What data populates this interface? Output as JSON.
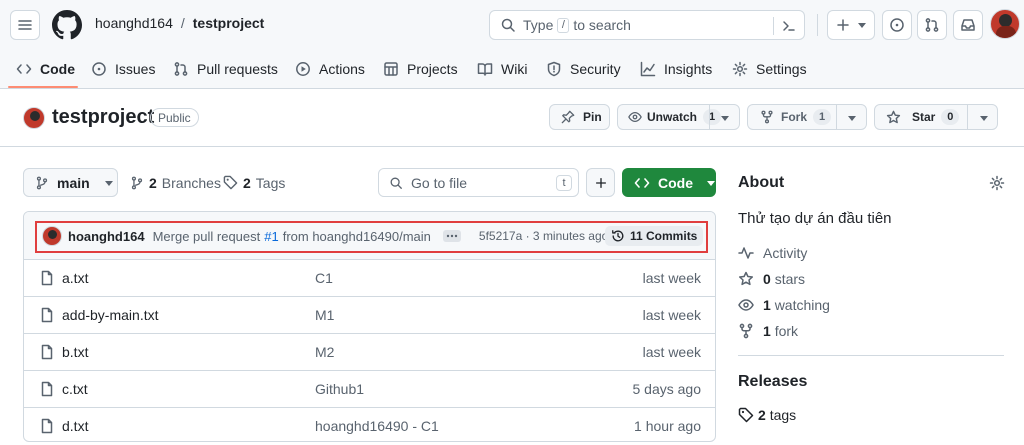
{
  "header": {
    "owner": "hoanghd164",
    "slash": "/",
    "repo": "testproject",
    "search_prefix": "Type",
    "search_key": "/",
    "search_suffix": "to search"
  },
  "nav": {
    "tabs": [
      {
        "label": "Code"
      },
      {
        "label": "Issues"
      },
      {
        "label": "Pull requests"
      },
      {
        "label": "Actions"
      },
      {
        "label": "Projects"
      },
      {
        "label": "Wiki"
      },
      {
        "label": "Security"
      },
      {
        "label": "Insights"
      },
      {
        "label": "Settings"
      }
    ]
  },
  "repo": {
    "name": "testproject",
    "visibility": "Public",
    "pin_label": "Pin",
    "unwatch_label": "Unwatch",
    "unwatch_count": "1",
    "fork_label": "Fork",
    "fork_count": "1",
    "star_label": "Star",
    "star_count": "0"
  },
  "toolbar": {
    "branch": "main",
    "branches_count": "2",
    "branches_label": "Branches",
    "tags_count": "2",
    "tags_label": "Tags",
    "goto_placeholder": "Go to file",
    "goto_key": "t",
    "code_label": "Code"
  },
  "commit": {
    "author": "hoanghd164",
    "message_prefix": "Merge pull request",
    "pr_ref": "#1",
    "message_suffix": "from hoanghd16490/main",
    "sha_time": "5f5217a · 3 minutes ago",
    "commits_label": "11 Commits"
  },
  "files": [
    {
      "name": "a.txt",
      "message": "C1",
      "date": "last week"
    },
    {
      "name": "add-by-main.txt",
      "message": "M1",
      "date": "last week"
    },
    {
      "name": "b.txt",
      "message": "M2",
      "date": "last week"
    },
    {
      "name": "c.txt",
      "message": "Github1",
      "date": "5 days ago"
    },
    {
      "name": "d.txt",
      "message": "hoanghd16490 - C1",
      "date": "1 hour ago"
    }
  ],
  "about": {
    "title": "About",
    "description": "Thử tạo dự án đầu tiên",
    "activity_label": "Activity",
    "stars_count": "0",
    "stars_label": "stars",
    "watching_count": "1",
    "watching_label": "watching",
    "fork_count": "1",
    "fork_label": "fork",
    "releases_title": "Releases",
    "tags_count": "2",
    "tags_label": "tags"
  },
  "colors": {
    "accent_green": "#1f883d",
    "active_tab_underline": "#fd8c73",
    "link_blue": "#0969da",
    "highlight_red": "#e03e3e"
  }
}
